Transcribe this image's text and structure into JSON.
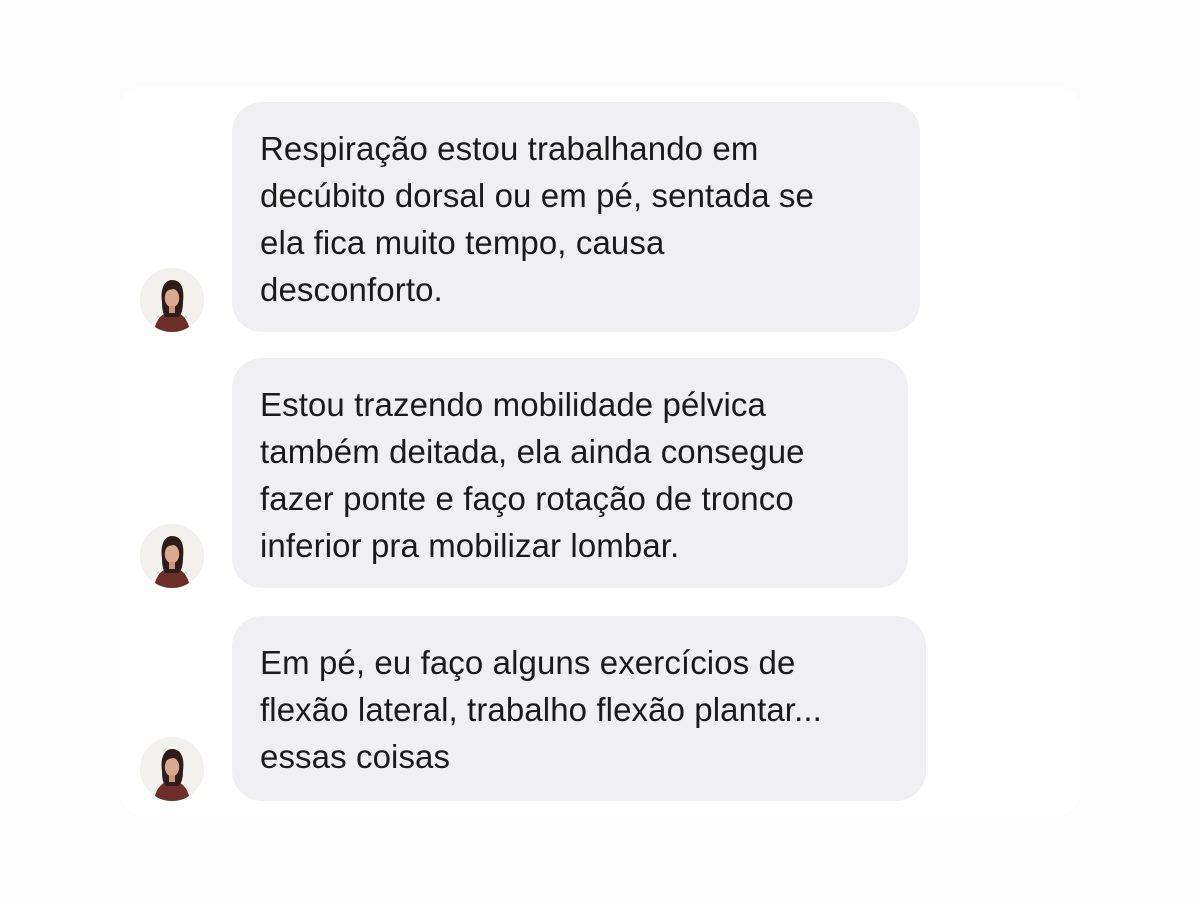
{
  "messages": [
    {
      "sender": "incoming",
      "lines": [
        "Respiração estou trabalhando em",
        "decúbito dorsal ou em pé, sentada se",
        "ela fica muito tempo, causa",
        "desconforto."
      ]
    },
    {
      "sender": "incoming",
      "lines": [
        "Estou trazendo mobilidade pélvica",
        "também deitada, ela ainda consegue",
        "fazer ponte e faço rotação de tronco",
        "inferior pra mobilizar lombar."
      ]
    },
    {
      "sender": "incoming",
      "lines": [
        "Em pé, eu faço alguns exercícios de",
        "flexão lateral, trabalho flexão plantar...",
        "essas coisas"
      ]
    }
  ],
  "colors": {
    "page_background": "#fcfcfc",
    "bubble_background": "#f0f0f2",
    "text": "#1a1a1a"
  },
  "icons": {
    "avatar": "profile-photo-avatar"
  }
}
